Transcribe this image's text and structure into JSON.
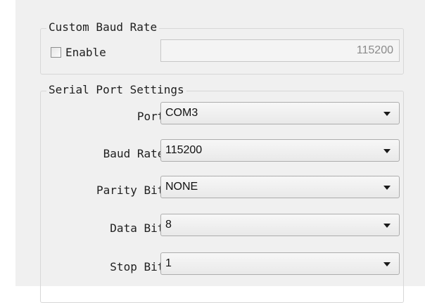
{
  "custom_baud": {
    "title": "Custom Baud Rate",
    "enable_label": "Enable",
    "enable_checked": false,
    "value": "115200"
  },
  "serial": {
    "title": "Serial Port Settings",
    "port": {
      "label": "Port:",
      "value": "COM3"
    },
    "baud_rate": {
      "label": "Baud Rate:",
      "value": "115200"
    },
    "parity_bit": {
      "label": "Parity Bit:",
      "value": "NONE"
    },
    "data_bit": {
      "label": "Data Bit:",
      "value": "8"
    },
    "stop_bit": {
      "label": "Stop Bit:",
      "value": "1"
    }
  },
  "icons": {
    "dropdown": "chevron-down-icon",
    "checkbox": "checkbox-unchecked"
  },
  "colors": {
    "panel_bg": "#f0f0f0",
    "group_border": "#d7d7d7",
    "field_text_disabled": "#8a8a8a"
  }
}
